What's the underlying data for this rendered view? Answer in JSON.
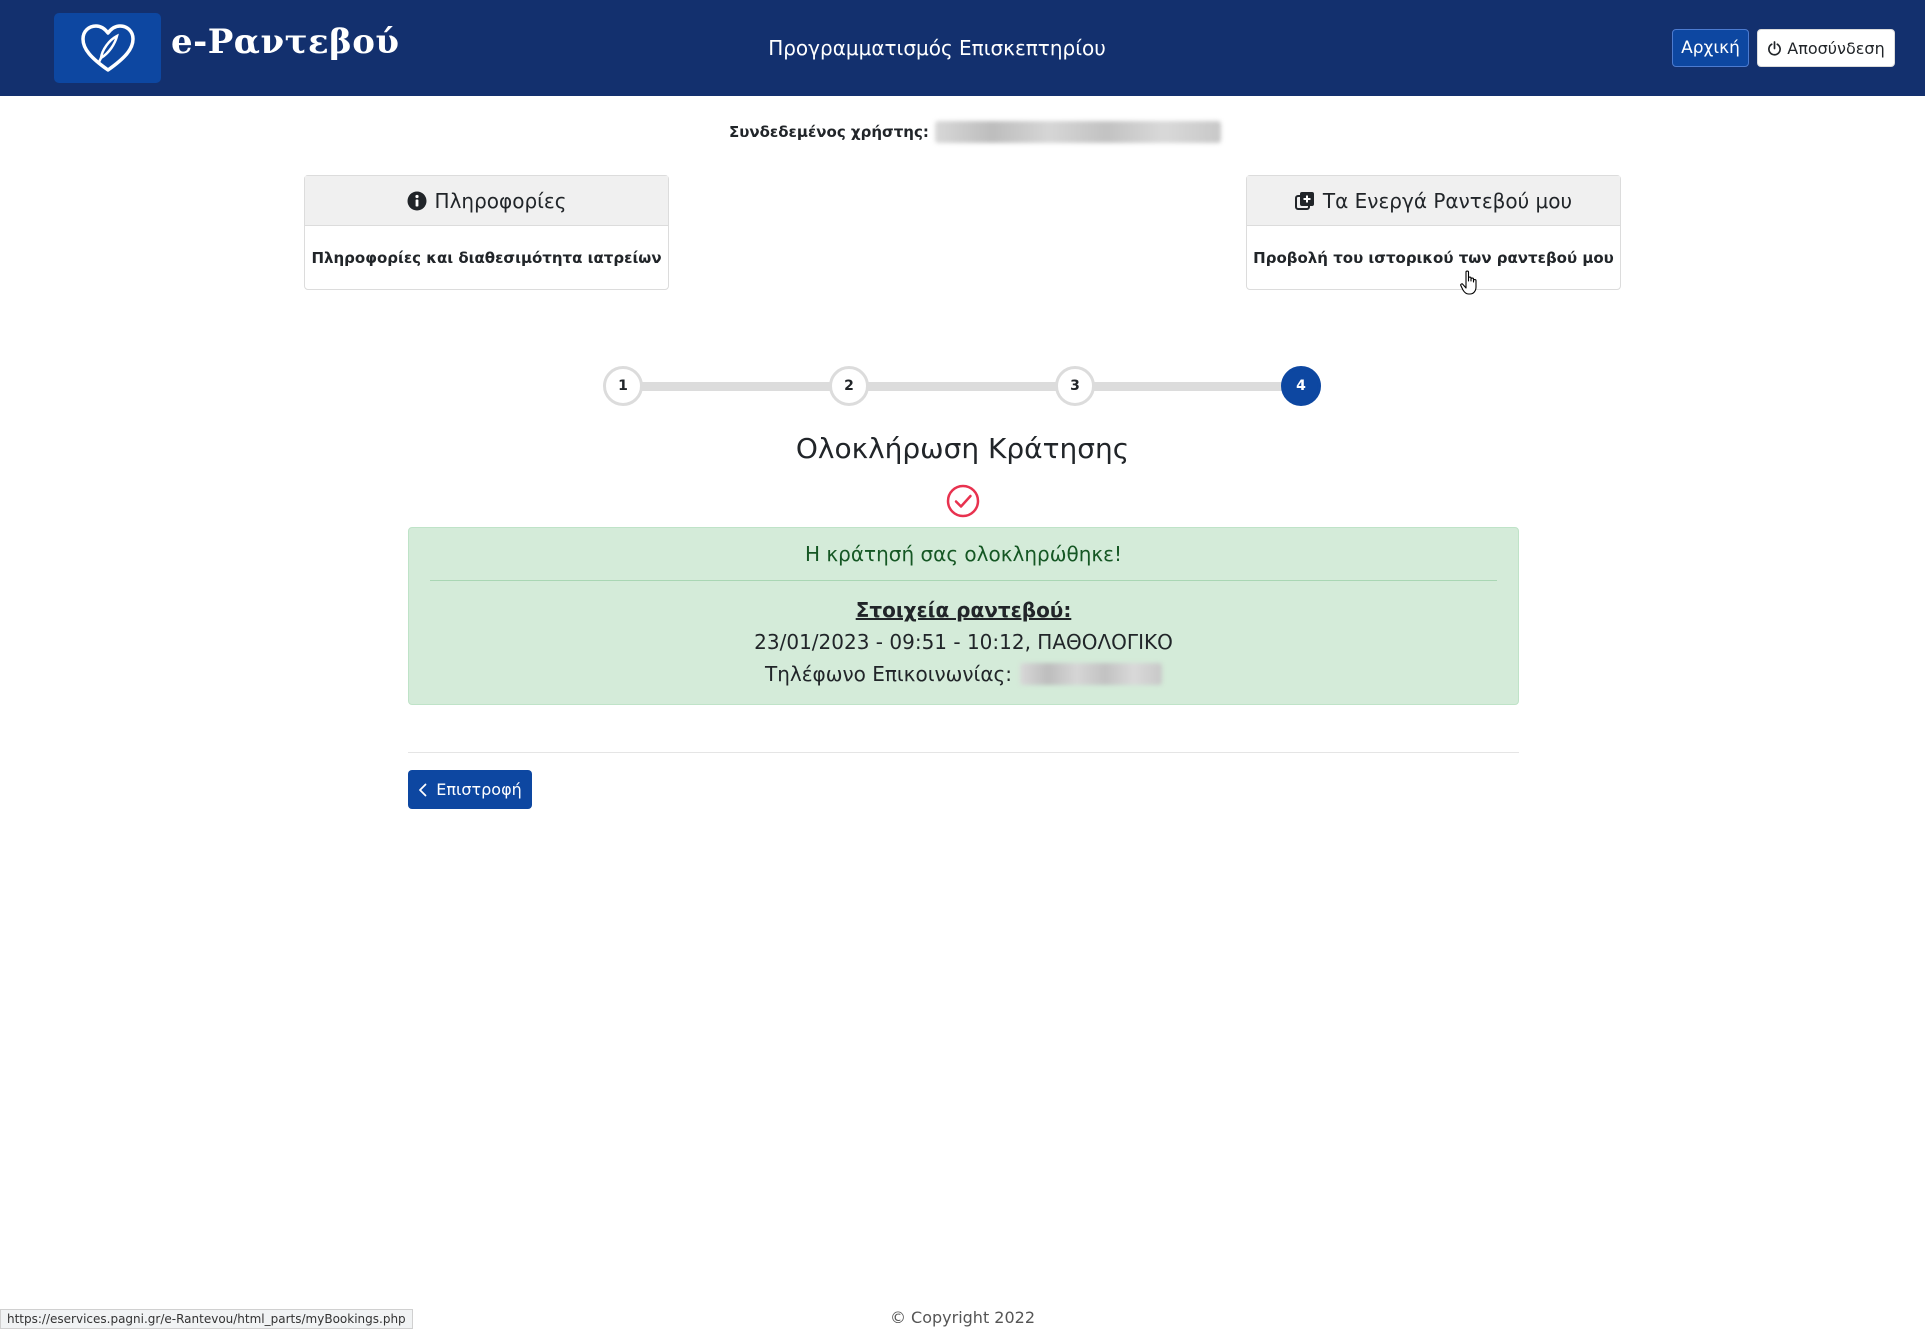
{
  "header": {
    "brand": "e-Ραντεβού",
    "title": "Προγραμματισμός Επισκεπτηρίου",
    "home_label": "Αρχική",
    "logout_label": "Αποσύνδεση",
    "logo_icon": "heart-pen-icon",
    "logout_icon": "power-icon"
  },
  "user": {
    "label": "Συνδεδεμένος χρήστης:"
  },
  "cards": {
    "info": {
      "title": "Πληροφορίες",
      "body": "Πληροφορίες και διαθεσιμότητα ιατρείων",
      "icon": "info-circle-icon"
    },
    "active": {
      "title": "Τα Ενεργά Ραντεβού μου",
      "body": "Προβολή του ιστορικού των ραντεβού μου",
      "icon": "add-copy-icon"
    }
  },
  "stepper": {
    "steps": [
      "1",
      "2",
      "3",
      "4"
    ],
    "current": 4
  },
  "section": {
    "title": "Ολοκλήρωση Κράτησης",
    "icon": "check-circle-icon"
  },
  "alert": {
    "title": "Η κράτησή σας ολοκληρώθηκε!",
    "subtitle": "Στοιχεία ραντεβού:",
    "details": "23/01/2023 - 09:51 - 10:12, ΠΑΘΟΛΟΓΙΚΟ",
    "phone_label": "Τηλέφωνο Επικοινωνίας:"
  },
  "actions": {
    "back_label": "Επιστροφή",
    "back_icon": "chevron-left-icon"
  },
  "footer": {
    "copyright": "© Copyright 2022"
  },
  "statusbar": {
    "url": "https://eservices.pagni.gr/e-Rantevou/html_parts/myBookings.php"
  },
  "colors": {
    "navbar": "#13306e",
    "primary": "#0d47a1",
    "success_bg": "#d4ebd9",
    "success_text": "#155724",
    "check_red": "#e8324f"
  }
}
